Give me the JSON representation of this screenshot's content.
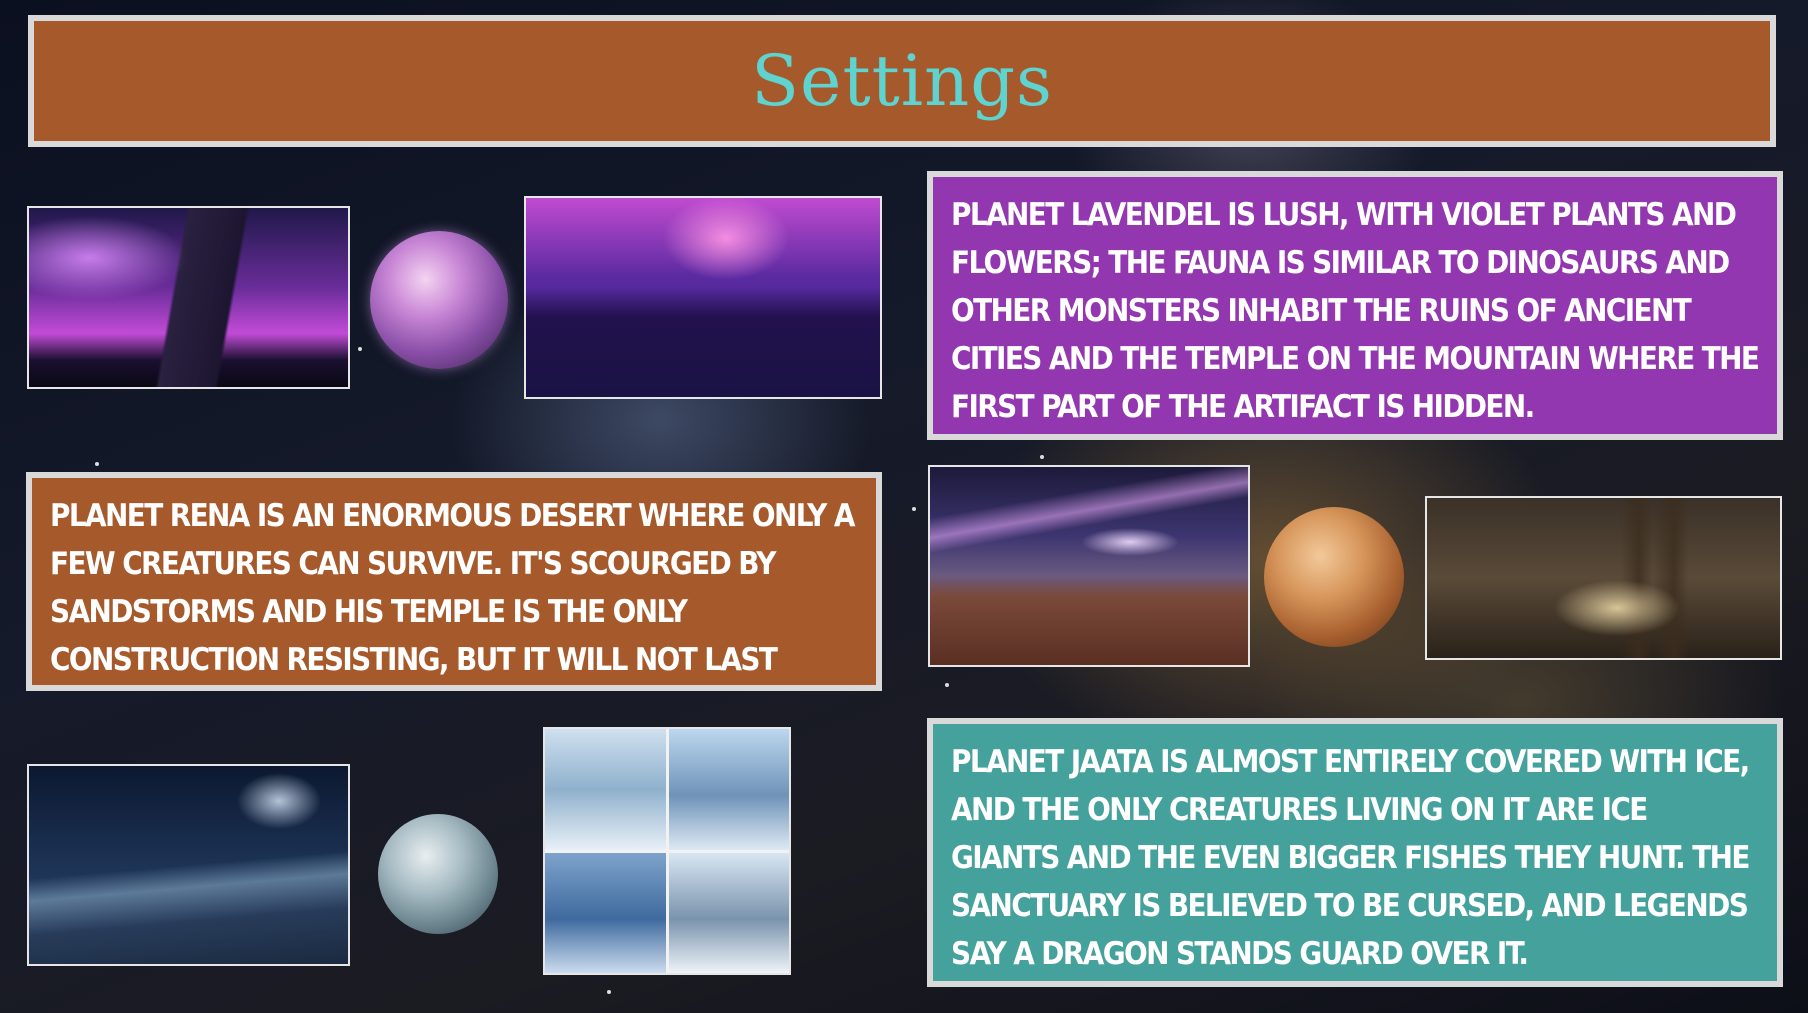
{
  "slide": {
    "title": "Settings"
  },
  "planets": {
    "lavendel": {
      "description": "Planet Lavendel is lush, with violet plants and flowers; the fauna is similar to dinosaurs and other monsters inhabit the ruins of ancient cities and the temple on the mountain where the first part of the artifact is hidden.",
      "color": "#9337b0"
    },
    "rena": {
      "description": "Planet Rena is an enormous desert where only a few creatures can survive. It's scourged by sandstorms and his temple is the only construction resisting, but it will not last long.",
      "color": "#a65a2c"
    },
    "jaata": {
      "description": "Planet Jaata is almost entirely covered with ice, and the only creatures living on it are ice giants and the even bigger fishes they hunt. The sanctuary is believed to be cursed, and legends say a dragon stands guard over it.",
      "color": "#45a19c"
    }
  },
  "colors": {
    "title_text": "#5ed3d0",
    "box_border": "#d9d9d9"
  }
}
